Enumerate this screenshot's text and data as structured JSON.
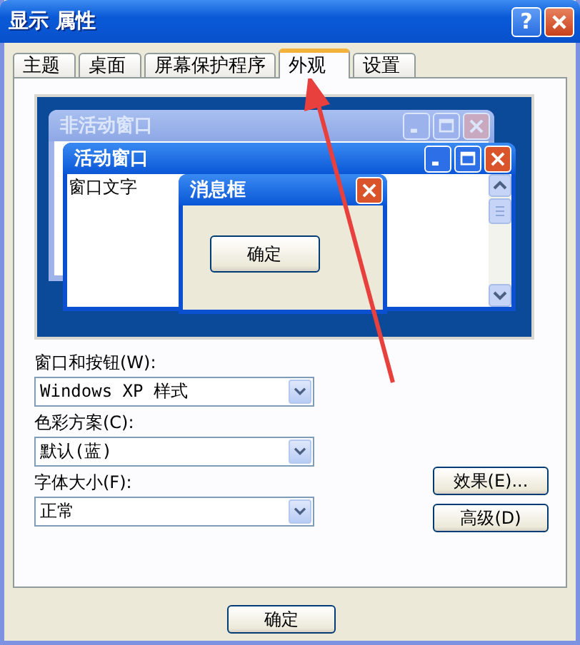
{
  "window": {
    "title": "显示 属性",
    "help_button": "?"
  },
  "tabs": [
    {
      "label": "主题",
      "selected": false
    },
    {
      "label": "桌面",
      "selected": false
    },
    {
      "label": "屏幕保护程序",
      "selected": false
    },
    {
      "label": "外观",
      "selected": true
    },
    {
      "label": "设置",
      "selected": false
    }
  ],
  "preview": {
    "inactive_window": {
      "title": "非活动窗口"
    },
    "active_window": {
      "title": "活动窗口",
      "text": "窗口文字"
    },
    "message_box": {
      "title": "消息框",
      "button": "确定"
    }
  },
  "fields": [
    {
      "label": "窗口和按钮(W):",
      "value": "Windows XP 样式"
    },
    {
      "label": "色彩方案(C):",
      "value": "默认(蓝)"
    },
    {
      "label": "字体大小(F):",
      "value": "正常"
    }
  ],
  "side_buttons": [
    "效果(E)...",
    "高级(D)"
  ],
  "footer_buttons": [
    "确定"
  ]
}
